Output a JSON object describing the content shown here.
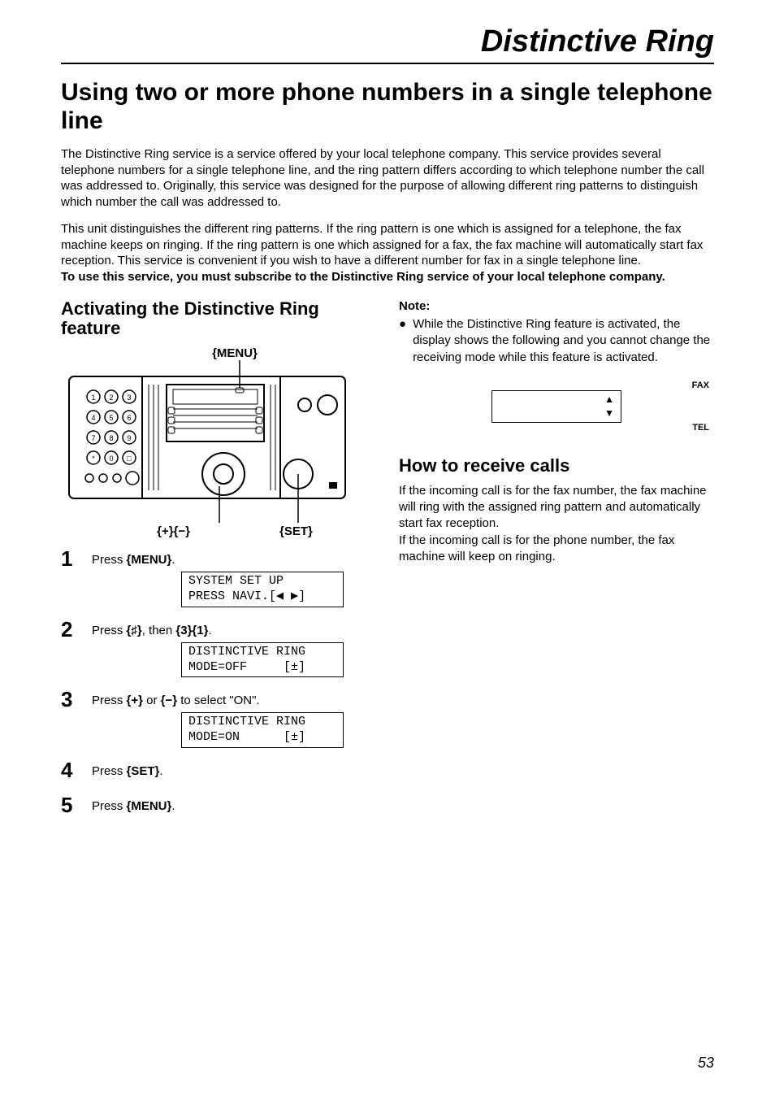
{
  "header": "Distinctive Ring",
  "main_heading": "Using two or more phone numbers in a single telephone line",
  "para1": "The Distinctive Ring service is a service offered by your local telephone company. This service provides several telephone numbers for a single telephone line, and the ring pattern differs according to which telephone number the call was addressed to. Originally, this service was designed for the purpose of allowing different ring patterns to distinguish which number the call was addressed to.",
  "para2": "This unit distinguishes the different ring patterns. If the ring pattern is one which is assigned for a telephone, the fax machine keeps on ringing. If the ring pattern is one which assigned for a fax, the fax machine will automatically start fax reception. This service is convenient if you wish to have a different number for fax in a single telephone line.",
  "para2_bold": "To use this service, you must subscribe to the Distinctive Ring service of your local telephone company.",
  "left_heading": "Activating the Distinctive Ring feature",
  "diagram": {
    "menu": "{MENU}",
    "plusminus": "{+}{−}",
    "set": "{SET}"
  },
  "steps": [
    {
      "n": "1",
      "text_parts": [
        "Press ",
        "{MENU}",
        "."
      ],
      "lcd": "SYSTEM SET UP\nPRESS NAVI.[◀ ▶]"
    },
    {
      "n": "2",
      "text_parts": [
        "Press ",
        "{♯}",
        ", then ",
        "{3}{1}",
        "."
      ],
      "lcd": "DISTINCTIVE RING\nMODE=OFF     [±]"
    },
    {
      "n": "3",
      "text_parts": [
        "Press ",
        "{+}",
        " or ",
        "{−}",
        " to select \"ON\"."
      ],
      "lcd": "DISTINCTIVE RING\nMODE=ON      [±]"
    },
    {
      "n": "4",
      "text_parts": [
        "Press ",
        "{SET}",
        "."
      ],
      "lcd": null
    },
    {
      "n": "5",
      "text_parts": [
        "Press ",
        "{MENU}",
        "."
      ],
      "lcd": null
    }
  ],
  "note": {
    "head": "Note:",
    "body": "While the Distinctive Ring feature is activated, the display shows the following and you cannot change the receiving mode while this feature is activated."
  },
  "indicator": {
    "fax": "FAX",
    "tel": "TEL"
  },
  "right_heading": "How to receive calls",
  "receive_text": "If the incoming call is for the fax number, the fax machine will ring with the assigned ring pattern and automatically start fax reception.\nIf the incoming call is for the phone number, the fax machine will keep on ringing.",
  "pagenum": "53"
}
